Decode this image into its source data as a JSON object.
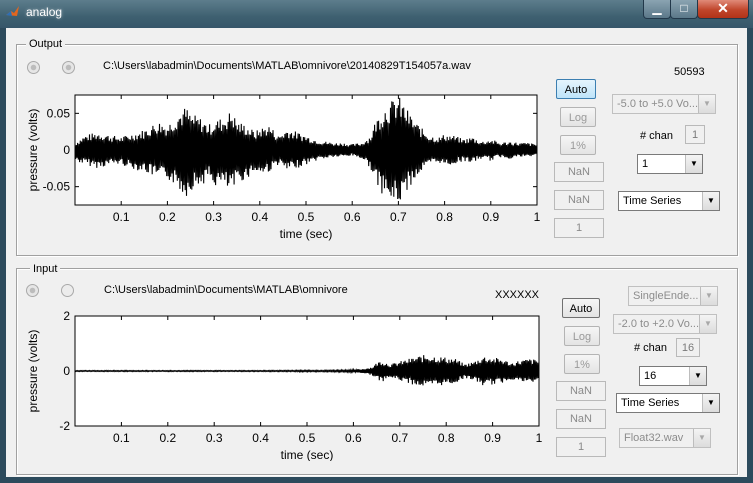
{
  "window": {
    "title": "analog",
    "minimize_glyph": "▁",
    "maximize_glyph": "□",
    "close_glyph": "✕"
  },
  "output": {
    "panel_title": "Output",
    "file_path": "C:\\Users\\labadmin\\Documents\\MATLAB\\omnivore\\20140829T154057a.wav",
    "sample_count": "50593",
    "buttons": {
      "auto": "Auto",
      "log": "Log",
      "percent": "1%",
      "nan1": "NaN",
      "nan2": "NaN",
      "one": "1"
    },
    "range_select": "-5.0 to +5.0 Vo...",
    "nchan_label": "# chan",
    "nchan_value": "1",
    "channel_select": "1",
    "view_select": "Time Series",
    "plot": {
      "ylabel": "pressure (volts)",
      "xlabel": "time (sec)",
      "yticks": [
        "0.05",
        "0",
        "-0.05"
      ],
      "xticks": [
        "0.1",
        "0.2",
        "0.3",
        "0.4",
        "0.5",
        "0.6",
        "0.7",
        "0.8",
        "0.9",
        "1"
      ]
    }
  },
  "input": {
    "panel_title": "Input",
    "file_path": "C:\\Users\\labadmin\\Documents\\MATLAB\\omnivore",
    "sample_count": "XXXXXX",
    "buttons": {
      "auto": "Auto",
      "log": "Log",
      "percent": "1%",
      "nan1": "NaN",
      "nan2": "NaN",
      "one": "1"
    },
    "mode_select": "SingleEnde...",
    "range_select": "-2.0 to +2.0 Vo...",
    "nchan_label": "# chan",
    "nchan_value": "16",
    "channel_select": "16",
    "view_select": "Time Series",
    "format_select": "Float32.wav",
    "plot": {
      "ylabel": "pressure (volts)",
      "xlabel": "time (sec)",
      "yticks": [
        "2",
        "0",
        "-2"
      ],
      "xticks": [
        "0.1",
        "0.2",
        "0.3",
        "0.4",
        "0.5",
        "0.6",
        "0.7",
        "0.8",
        "0.9",
        "1"
      ]
    }
  },
  "chart_data": [
    {
      "type": "line",
      "xlabel": "time (sec)",
      "ylabel": "pressure (volts)",
      "xlim": [
        0,
        1
      ],
      "ylim": [
        -0.075,
        0.075
      ],
      "grid": false,
      "envelope": {
        "x": [
          0,
          0.02,
          0.05,
          0.08,
          0.1,
          0.12,
          0.15,
          0.18,
          0.2,
          0.22,
          0.24,
          0.25,
          0.27,
          0.29,
          0.3,
          0.32,
          0.34,
          0.35,
          0.37,
          0.39,
          0.4,
          0.42,
          0.44,
          0.46,
          0.48,
          0.5,
          0.52,
          0.54,
          0.56,
          0.58,
          0.6,
          0.62,
          0.64,
          0.65,
          0.67,
          0.69,
          0.7,
          0.71,
          0.73,
          0.75,
          0.77,
          0.79,
          0.8,
          0.82,
          0.84,
          0.86,
          0.88,
          0.9,
          0.92,
          0.94,
          0.96,
          0.98,
          1
        ],
        "upper": [
          0.01,
          0.02,
          0.025,
          0.02,
          0.018,
          0.022,
          0.028,
          0.04,
          0.035,
          0.05,
          0.06,
          0.05,
          0.045,
          0.035,
          0.04,
          0.045,
          0.055,
          0.04,
          0.035,
          0.025,
          0.03,
          0.035,
          0.02,
          0.03,
          0.025,
          0.02,
          0.015,
          0.012,
          0.01,
          0.01,
          0.008,
          0.01,
          0.02,
          0.04,
          0.06,
          0.07,
          0.075,
          0.065,
          0.045,
          0.03,
          0.02,
          0.018,
          0.022,
          0.02,
          0.015,
          0.018,
          0.012,
          0.015,
          0.01,
          0.012,
          0.01,
          0.01,
          0.008
        ],
        "lower": [
          -0.015,
          -0.02,
          -0.025,
          -0.02,
          -0.02,
          -0.025,
          -0.03,
          -0.04,
          -0.04,
          -0.05,
          -0.065,
          -0.055,
          -0.05,
          -0.04,
          -0.05,
          -0.05,
          -0.06,
          -0.045,
          -0.04,
          -0.03,
          -0.035,
          -0.03,
          -0.02,
          -0.03,
          -0.025,
          -0.02,
          -0.015,
          -0.012,
          -0.01,
          -0.01,
          -0.008,
          -0.012,
          -0.025,
          -0.045,
          -0.065,
          -0.075,
          -0.075,
          -0.065,
          -0.045,
          -0.03,
          -0.02,
          -0.018,
          -0.022,
          -0.02,
          -0.015,
          -0.018,
          -0.012,
          -0.015,
          -0.01,
          -0.012,
          -0.01,
          -0.01,
          -0.008
        ]
      }
    },
    {
      "type": "line",
      "xlabel": "time (sec)",
      "ylabel": "pressure (volts)",
      "xlim": [
        0,
        1
      ],
      "ylim": [
        -2,
        2
      ],
      "grid": false,
      "envelope": {
        "x": [
          0,
          0.1,
          0.2,
          0.3,
          0.4,
          0.5,
          0.55,
          0.6,
          0.62,
          0.64,
          0.65,
          0.66,
          0.68,
          0.7,
          0.72,
          0.74,
          0.76,
          0.78,
          0.8,
          0.82,
          0.84,
          0.86,
          0.88,
          0.9,
          0.92,
          0.94,
          0.96,
          0.98,
          1
        ],
        "upper": [
          0.02,
          0.02,
          0.02,
          0.02,
          0.02,
          0.03,
          0.03,
          0.05,
          0.08,
          0.15,
          0.3,
          0.4,
          0.25,
          0.35,
          0.45,
          0.55,
          0.6,
          0.55,
          0.5,
          0.45,
          0.25,
          0.35,
          0.55,
          0.5,
          0.45,
          0.3,
          0.4,
          0.45,
          0.4
        ],
        "lower": [
          -0.02,
          -0.02,
          -0.02,
          -0.02,
          -0.02,
          -0.03,
          -0.03,
          -0.05,
          -0.08,
          -0.15,
          -0.3,
          -0.4,
          -0.25,
          -0.35,
          -0.45,
          -0.55,
          -0.6,
          -0.55,
          -0.5,
          -0.45,
          -0.25,
          -0.35,
          -0.55,
          -0.5,
          -0.45,
          -0.3,
          -0.4,
          -0.45,
          -0.4
        ]
      }
    }
  ]
}
